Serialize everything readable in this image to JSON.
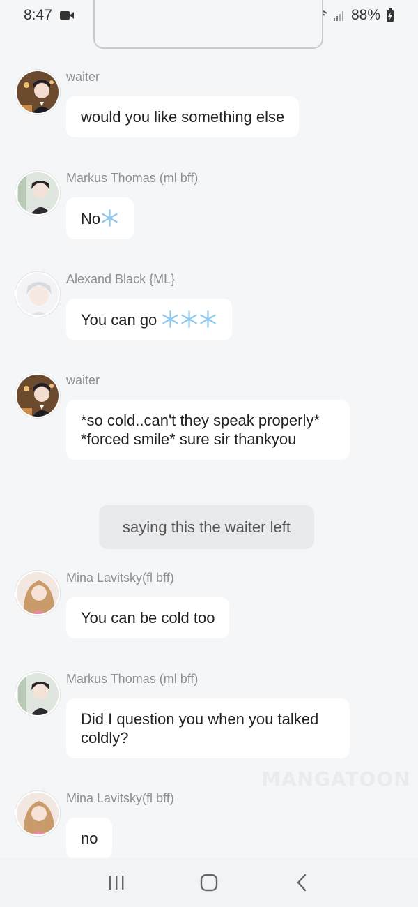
{
  "status_bar": {
    "time": "8:47",
    "battery": "88%",
    "icons": [
      "video-icon",
      "battery-saver-icon",
      "alarm-icon",
      "wifi-icon",
      "signal-icon",
      "battery-icon"
    ]
  },
  "messages": [
    {
      "sender": "waiter",
      "text": "would you like something else",
      "avatar": "waiter-avatar"
    },
    {
      "sender": "Markus Thomas  (ml bff)",
      "text": "No",
      "emoji": "snowflake-icon",
      "avatar": "markus-avatar"
    },
    {
      "sender": "Alexand Black {ML}",
      "text": "You can go ",
      "emoji": "snowflake-icon x3",
      "avatar": "alexand-avatar"
    },
    {
      "sender": "waiter",
      "text": "*so cold..can't they speak properly* *forced smile* sure sir thankyou",
      "avatar": "waiter-avatar"
    },
    {
      "sender": "Mina Lavitsky(fl bff)",
      "text": "You can be cold too",
      "avatar": "mina-avatar"
    },
    {
      "sender": "Markus Thomas  (ml bff)",
      "text": "Did I question you when you talked coldly?",
      "avatar": "markus-avatar"
    },
    {
      "sender": "Mina Lavitsky(fl bff)",
      "text": "no",
      "avatar": "mina-avatar"
    }
  ],
  "narration": "saying this the waiter left",
  "watermark": "MANGATOON",
  "colors": {
    "background": "#f5f6f8",
    "bubble": "#ffffff",
    "narration_bg": "#e9eaec",
    "sender_text": "#8c8f94"
  },
  "nav": {
    "icons": [
      "recent-apps-icon",
      "home-icon",
      "back-icon"
    ]
  }
}
